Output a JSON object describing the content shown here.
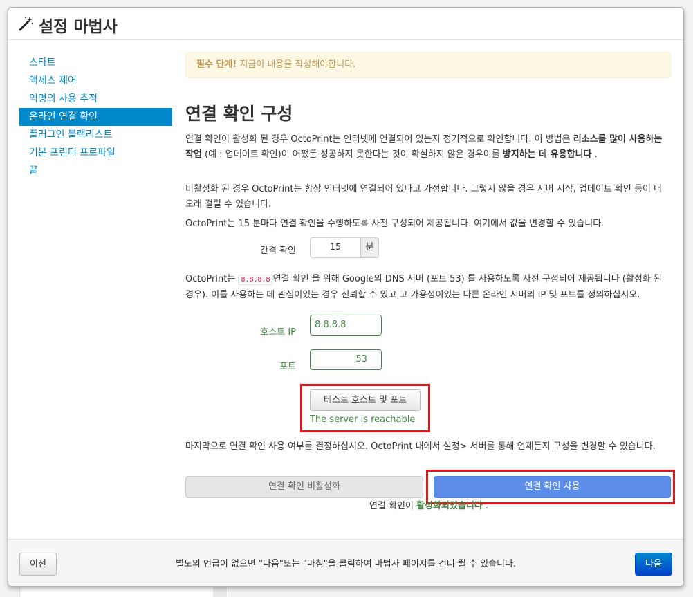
{
  "header": {
    "title": "설정 마법사",
    "icon": "magic-wand-icon"
  },
  "sidebar": {
    "items": [
      {
        "label": "스타트"
      },
      {
        "label": "액세스 제어"
      },
      {
        "label": "익명의 사용 추적"
      },
      {
        "label": "온라인 연결 확인",
        "active": true
      },
      {
        "label": "플러그인 블랙리스트"
      },
      {
        "label": "기본 프린터 프로파일"
      },
      {
        "label": "끝"
      }
    ]
  },
  "alert": {
    "strong": "필수 단계!",
    "text": " 지금이 내용을 작성해야합니다."
  },
  "main": {
    "title": "연결 확인 구성",
    "p1": {
      "t1": "연결 확인이 활성화 된 경우 OctoPrint는 인터넷에 연결되어 있는지 정기적으로 확인합니다. 이 방법은 ",
      "b1": "리소스를 많이 사용하는 작업",
      "t2": " (예 : 업데이트 확인)이 어쨌든 성공하지 못한다는 것이 확실하지 않은 경우이를 ",
      "b2": "방지하는 데 유용합니다",
      "t3": " ."
    },
    "p2": "비활성화 된 경우 OctoPrint는 항상 인터넷에 연결되어 있다고 가정합니다. 그렇지 않을 경우 서버 시작, 업데이트 확인 등이 더 오래 걸릴 수 있습니다.",
    "p3": "OctoPrint는 15 분마다 연결 확인을 수행하도록 사전 구성되어 제공됩니다. 여기에서 값을 변경할 수 있습니다.",
    "interval": {
      "label": "간격 확인",
      "value": "15",
      "unit": "분"
    },
    "p4": {
      "t1": "OctoPrint는 ",
      "code": "8.8.8.8",
      "t2": "연결 확인 을 위해 Google의 DNS 서버 (포트 53) 를 사용하도록 사전 구성되어 제공됩니다 (활성화 된 경우). 이를 사용하는 데 관심이있는 경우 신뢰할 수 있고 고 가용성이있는 다른 온라인 서버의 IP 및 포트를 정의하십시오."
    },
    "host": {
      "label": "호스트 IP",
      "value": "8.8.8.8"
    },
    "port": {
      "label": "포트",
      "value": "53"
    },
    "test_button": "테스트 호스트 및 포트",
    "test_result": "The server is reachable",
    "p5": "마지막으로 연결 확인 사용 여부를 결정하십시오. OctoPrint 내에서 설정> 서버를 통해 언제든지 구성을 변경할 수 있습니다.",
    "disable_button": "연결 확인 비활성화",
    "enable_button": "연결 확인 사용",
    "status": {
      "prefix": "연결 확인이 ",
      "state": "활성화되었습니다",
      "suffix": " ."
    }
  },
  "footer": {
    "prev_label": "이전",
    "note": "별도의 언급이 없으면 \"다음\"또는 \"마침\"을 클릭하여 마법사 페이지를 건너 뛸 수 있습니다.",
    "next_label": "다음"
  },
  "colors": {
    "accent": "#0088cc",
    "success": "#468847",
    "primary_button": "#5c8de8",
    "highlight": "#e0161d"
  }
}
